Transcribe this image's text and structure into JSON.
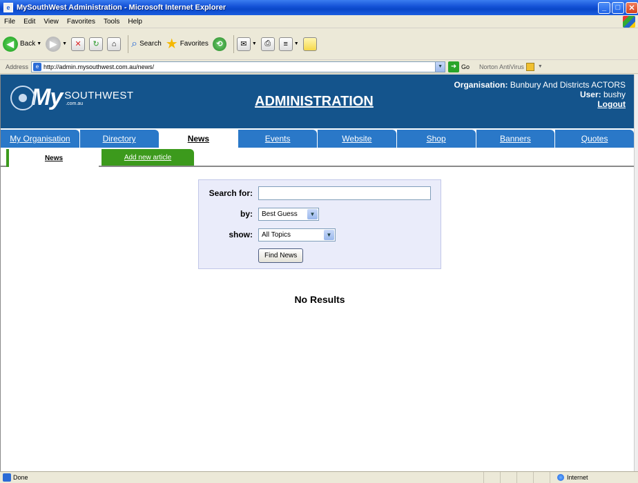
{
  "window": {
    "title": "MySouthWest Administration - Microsoft Internet Explorer",
    "controls": {
      "minimize": "_",
      "maximize": "□",
      "close": "✕"
    }
  },
  "menu": [
    "File",
    "Edit",
    "View",
    "Favorites",
    "Tools",
    "Help"
  ],
  "toolbar": {
    "back_label": "Back",
    "search_label": "Search",
    "favorites_label": "Favorites"
  },
  "addressbar": {
    "label": "Address",
    "url": "http://admin.mysouthwest.com.au/news/",
    "go_label": "Go",
    "norton_label": "Norton AntiVirus"
  },
  "site": {
    "logo_my": "My",
    "logo_southwest": "SOUTHWEST",
    "logo_domain": ".com.au",
    "title": "ADMINISTRATION",
    "organisation_label": "Organisation:",
    "organisation_value": "Bunbury And Districts ACTORS",
    "user_label": "User:",
    "user_value": "bushy",
    "logout_label": "Logout"
  },
  "tabs": [
    {
      "label": "My Organisation"
    },
    {
      "label": "Directory"
    },
    {
      "label": "News"
    },
    {
      "label": "Events"
    },
    {
      "label": "Website"
    },
    {
      "label": "Shop"
    },
    {
      "label": "Banners"
    },
    {
      "label": "Quotes"
    }
  ],
  "active_tab": "News",
  "subtabs": {
    "news": "News",
    "add_new": "Add new article"
  },
  "search": {
    "search_for_label": "Search for:",
    "search_for_value": "",
    "by_label": "by:",
    "by_value": "Best Guess",
    "show_label": "show:",
    "show_value": "All Topics",
    "button_label": "Find News"
  },
  "results": {
    "message": "No Results"
  },
  "status": {
    "text": "Done",
    "zone": "Internet"
  }
}
